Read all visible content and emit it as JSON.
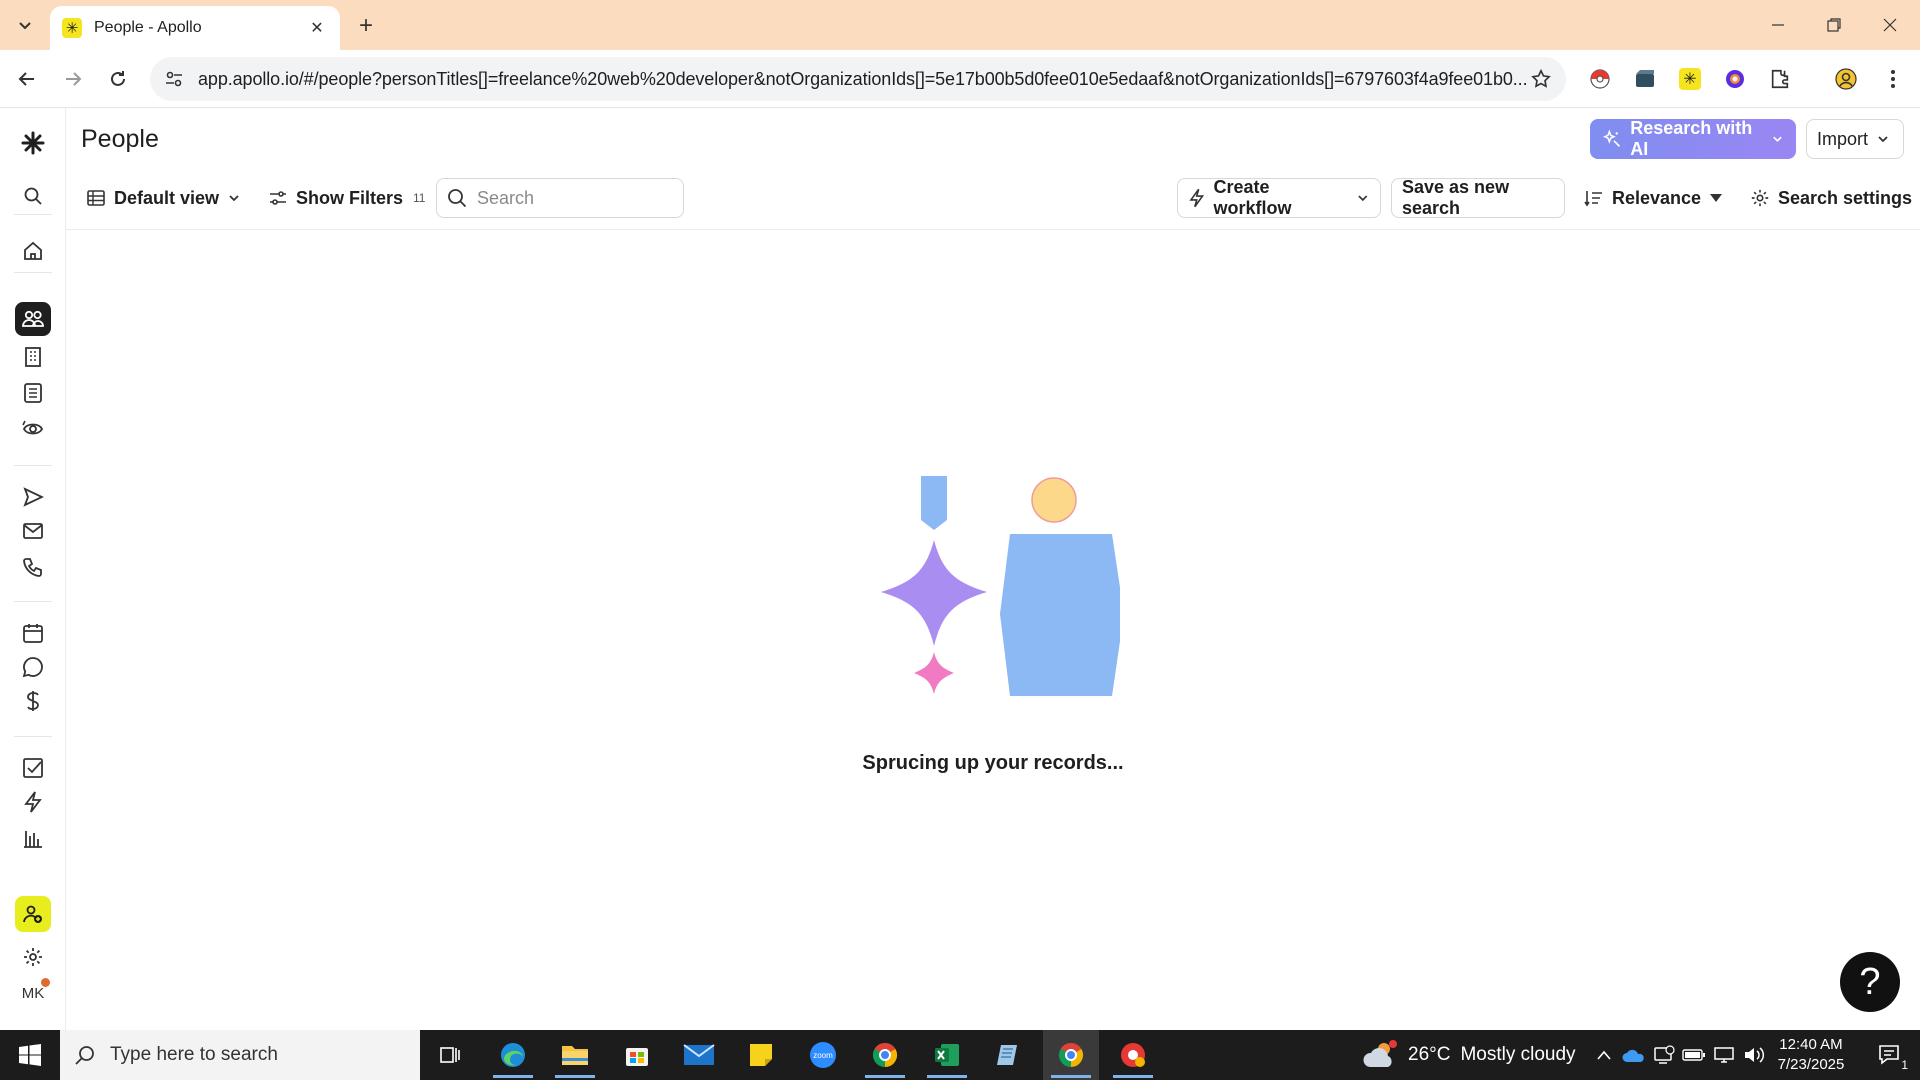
{
  "browser": {
    "tab_title": "People - Apollo",
    "url": "app.apollo.io/#/people?personTitles[]=freelance%20web%20developer&notOrganizationIds[]=5e17b00b5d0fee010e5edaaf&notOrganizationIds[]=6797603f4a9fee01b0..."
  },
  "page": {
    "title": "People",
    "research_ai_label": "Research with AI",
    "import_label": "Import"
  },
  "filterbar": {
    "view_label": "Default view",
    "show_filters_label": "Show Filters",
    "filters_count": "11",
    "search_placeholder": "Search",
    "create_workflow_label": "Create workflow",
    "save_search_label": "Save as new search",
    "sort_label": "Relevance",
    "settings_label": "Search settings"
  },
  "rail": {
    "avatar_initials": "MK"
  },
  "content": {
    "loading_text": "Sprucing up your records..."
  },
  "help": {
    "label": "?"
  },
  "taskbar": {
    "search_placeholder": "Type here to search",
    "weather_temp": "26°C",
    "weather_text": "Mostly cloudy",
    "time": "12:40 AM",
    "date": "7/23/2025",
    "notification_count": "1"
  },
  "colors": {
    "tabstrip": "#fbdcbe",
    "ai_button": "#8a93f0",
    "invite_button": "#e8ee1e",
    "active_rail": "#1f1f1f"
  }
}
